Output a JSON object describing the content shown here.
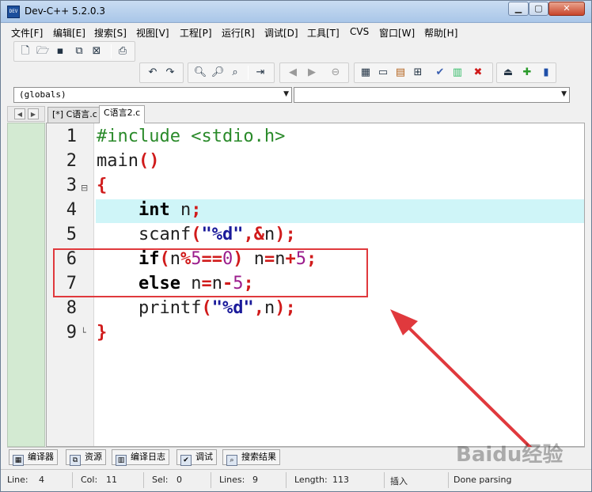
{
  "window": {
    "title": "Dev-C++ 5.2.0.3"
  },
  "menu": [
    "文件[F]",
    "编辑[E]",
    "搜索[S]",
    "视图[V]",
    "工程[P]",
    "运行[R]",
    "调试[D]",
    "工具[T]",
    "CVS",
    "窗口[W]",
    "帮助[H]"
  ],
  "toolbar": {
    "file_icons": [
      "new-file-icon",
      "open-file-icon",
      "save-icon",
      "save-all-icon",
      "close-file-icon",
      "print-icon"
    ],
    "edit_icons": [
      "undo-icon",
      "redo-icon",
      "find-icon",
      "find-next-icon",
      "replace-icon",
      "goto-line-icon"
    ],
    "project_icons": [
      "new-project-icon",
      "add-file-icon",
      "remove-file-icon"
    ],
    "compile_icons": [
      "compile-icon",
      "run-icon",
      "compile-run-icon",
      "rebuild-icon",
      "syntax-check-icon",
      "chart-icon",
      "stop-icon"
    ],
    "misc_icons": [
      "exit-icon",
      "add-icon",
      "bookmark-icon"
    ]
  },
  "combos": {
    "scope": "(globals)",
    "member": ""
  },
  "tabs": [
    {
      "label": "[*] C语言.c",
      "active": false
    },
    {
      "label": "C语言2.c",
      "active": true
    }
  ],
  "editor": {
    "highlight_line": 4,
    "lines": [
      {
        "num": "1",
        "fold": ""
      },
      {
        "num": "2",
        "fold": ""
      },
      {
        "num": "3",
        "fold": "⊟"
      },
      {
        "num": "4",
        "fold": ""
      },
      {
        "num": "5",
        "fold": ""
      },
      {
        "num": "6",
        "fold": ""
      },
      {
        "num": "7",
        "fold": ""
      },
      {
        "num": "8",
        "fold": ""
      },
      {
        "num": "9",
        "fold": "└"
      }
    ],
    "code": {
      "l1_pp": "#include <stdio.h>",
      "l2_main": "main",
      "l2_paren": "()",
      "l3_brace": "{",
      "l4_int": "int",
      "l4_rest": " n",
      "l4_semi": ";",
      "l5_scanf": "scanf",
      "l5_open": "(",
      "l5_str": "\"%d\"",
      "l5_comma": ",",
      "l5_amp": "&",
      "l5_n": "n",
      "l5_close": ");",
      "l6_if": "if",
      "l6_open": "(",
      "l6_n": "n",
      "l6_mod": "%",
      "l6_5": "5",
      "l6_eq": "==",
      "l6_0": "0",
      "l6_close": ")",
      "l6_sp": " n",
      "l6_assign": "=",
      "l6_n2": "n",
      "l6_plus": "+",
      "l6_5b": "5",
      "l6_semi": ";",
      "l7_else": "else",
      "l7_sp": " n",
      "l7_assign": "=",
      "l7_n": "n",
      "l7_minus": "-",
      "l7_5": "5",
      "l7_semi": ";",
      "l8_printf": "printf",
      "l8_open": "(",
      "l8_str": "\"%d\"",
      "l8_comma": ",",
      "l8_n": "n",
      "l8_close": ");",
      "l9_brace": "}"
    }
  },
  "bottom_tabs": [
    {
      "label": "编译器",
      "icon": "compiler-icon"
    },
    {
      "label": "资源",
      "icon": "resources-icon"
    },
    {
      "label": "编译日志",
      "icon": "compile-log-icon"
    },
    {
      "label": "调试",
      "icon": "debug-icon"
    },
    {
      "label": "搜索结果",
      "icon": "search-results-icon"
    }
  ],
  "status": {
    "line_label": "Line:",
    "line_value": "4",
    "col_label": "Col:",
    "col_value": "11",
    "sel_label": "Sel:",
    "sel_value": "0",
    "lines_label": "Lines:",
    "lines_value": "9",
    "length_label": "Length:",
    "length_value": "113",
    "mode": "插入",
    "parse_status": "Done parsing"
  },
  "watermark": "Baidu经验",
  "colors": {
    "highlight": "#cff5f8",
    "annotation": "#e0393d",
    "gutter": "#d3ead2"
  }
}
